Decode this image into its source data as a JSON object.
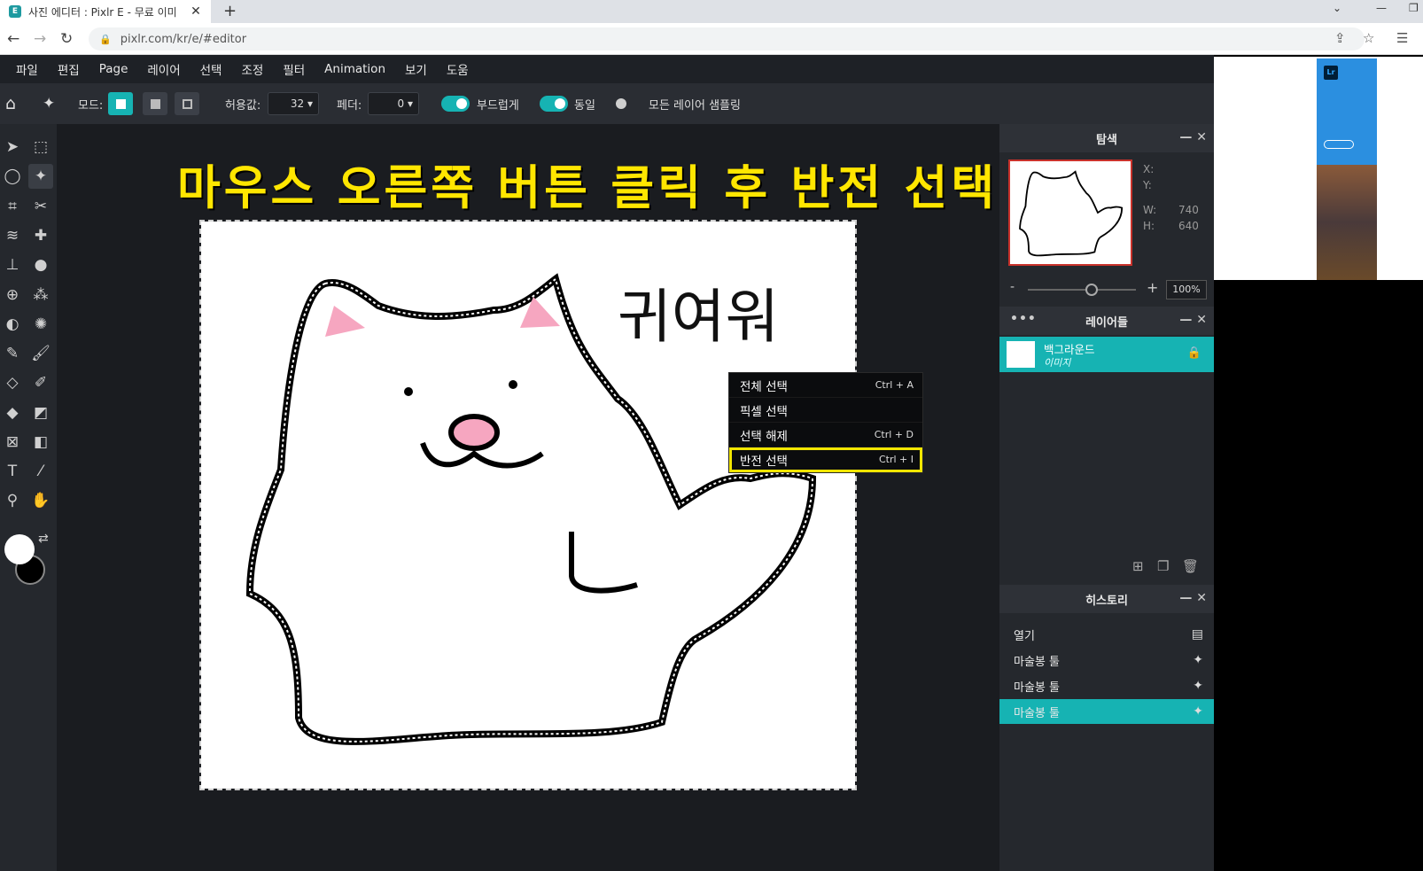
{
  "browser": {
    "tab_title": "사진 에디터 : Pixlr E - 무료 이미",
    "url": "pixlr.com/kr/e/#editor",
    "favicon": "E"
  },
  "menu": [
    "파일",
    "편집",
    "Page",
    "레이어",
    "선택",
    "조정",
    "필터",
    "Animation",
    "보기",
    "도움"
  ],
  "toolbar": {
    "mode_label": "모드:",
    "tolerance_label": "허용값:",
    "tolerance_value": "32",
    "feather_label": "페더:",
    "feather_value": "0",
    "smooth_label": "부드럽게",
    "contiguous_label": "동일",
    "sample_all_label": "모든 레이어 샘플링"
  },
  "caption": "마우스 오른쪽 버튼 클릭 후 반전 선택",
  "artwork_text": "귀여워",
  "context_menu": [
    {
      "label": "전체 선택",
      "shortcut": "Ctrl + A"
    },
    {
      "label": "픽셀 선택",
      "shortcut": ""
    },
    {
      "label": "선택 해제",
      "shortcut": "Ctrl + D"
    },
    {
      "label": "반전 선택",
      "shortcut": "Ctrl + I"
    }
  ],
  "navigator": {
    "title": "탐색",
    "x_label": "X:",
    "y_label": "Y:",
    "w_label": "W:",
    "w_value": "740",
    "h_label": "H:",
    "h_value": "640",
    "zoom": "100%",
    "zoom_minus": "-",
    "zoom_plus": "+"
  },
  "layers": {
    "title": "레이어들",
    "items": [
      {
        "name": "백그라운드",
        "type": "이미지"
      }
    ]
  },
  "history": {
    "title": "히스토리",
    "items": [
      "열기",
      "마술봉 툴",
      "마술봉 툴",
      "마술봉 툴"
    ]
  },
  "colors": {
    "accent": "#16b3b3",
    "highlight": "#f2e600",
    "caption": "#ffe600"
  }
}
